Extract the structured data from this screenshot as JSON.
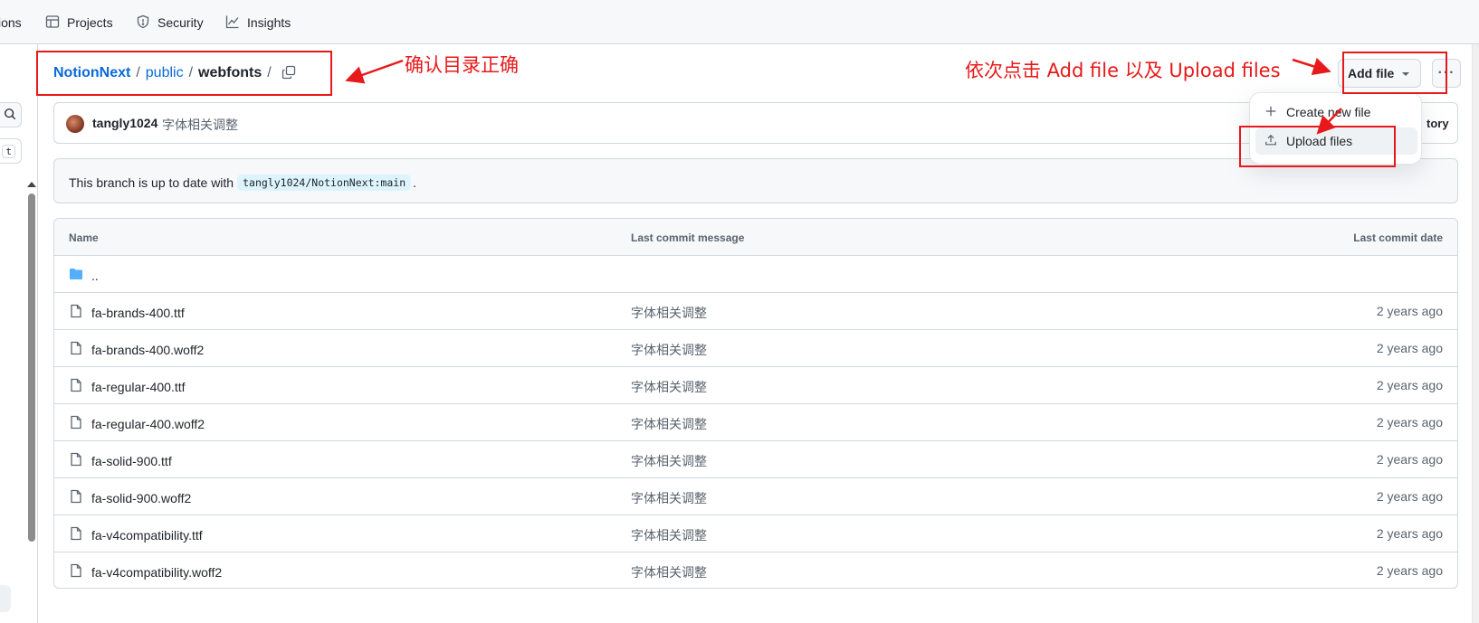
{
  "nav": {
    "partial_item": "ions",
    "projects": "Projects",
    "security": "Security",
    "insights": "Insights"
  },
  "breadcrumb": {
    "repo": "NotionNext",
    "folder": "public",
    "current": "webfonts",
    "sep": "/"
  },
  "annotations": {
    "left_note": "确认目录正确",
    "right_note": "依次点击 Add file 以及 Upload files",
    "color": "#e8191a"
  },
  "toolbar": {
    "add_file": "Add file",
    "more": "···"
  },
  "dropdown": {
    "create_new": "Create new file",
    "upload": "Upload files"
  },
  "commit": {
    "user": "tangly1024",
    "message": "字体相关调整",
    "history_partial": "tory"
  },
  "branch": {
    "text_prefix": "This branch is up to date with",
    "ref": "tangly1024/NotionNext:main",
    "text_suffix": "."
  },
  "table": {
    "headers": {
      "name": "Name",
      "message": "Last commit message",
      "date": "Last commit date"
    },
    "parent": "..",
    "rows": [
      {
        "name": "fa-brands-400.ttf",
        "message": "字体相关调整",
        "date": "2 years ago"
      },
      {
        "name": "fa-brands-400.woff2",
        "message": "字体相关调整",
        "date": "2 years ago"
      },
      {
        "name": "fa-regular-400.ttf",
        "message": "字体相关调整",
        "date": "2 years ago"
      },
      {
        "name": "fa-regular-400.woff2",
        "message": "字体相关调整",
        "date": "2 years ago"
      },
      {
        "name": "fa-solid-900.ttf",
        "message": "字体相关调整",
        "date": "2 years ago"
      },
      {
        "name": "fa-solid-900.woff2",
        "message": "字体相关调整",
        "date": "2 years ago"
      },
      {
        "name": "fa-v4compatibility.ttf",
        "message": "字体相关调整",
        "date": "2 years ago"
      },
      {
        "name": "fa-v4compatibility.woff2",
        "message": "字体相关调整",
        "date": "2 years ago"
      }
    ]
  },
  "colors": {
    "link": "#0969da",
    "accent_annotation": "#e8191a",
    "folder": "#54aeff"
  }
}
